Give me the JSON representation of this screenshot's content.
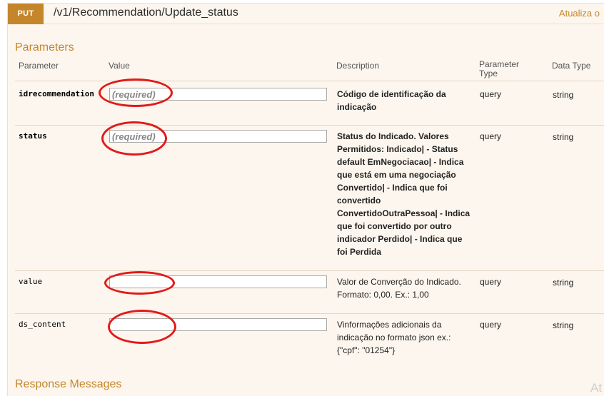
{
  "operation": {
    "method": "PUT",
    "path": "/v1/Recommendation/Update_status",
    "summary": "Atualiza o"
  },
  "sections": {
    "parameters_title": "Parameters",
    "response_title": "Response Messages"
  },
  "columns": {
    "parameter": "Parameter",
    "value": "Value",
    "description": "Description",
    "parameter_type": "Parameter Type",
    "data_type": "Data Type"
  },
  "params": [
    {
      "name": "idrecommendation",
      "placeholder": "(required)",
      "description": "Código de identificação da indicação",
      "param_type": "query",
      "data_type": "string"
    },
    {
      "name": "status",
      "placeholder": "(required)",
      "description": "Status do Indicado. Valores Permitidos: Indicado| - Status default EmNegociacao| - Indica que está em uma negociação Convertido| - Indica que foi convertido ConvertidoOutraPessoa| - Indica que foi convertido por outro indicador Perdido| - Indica que foi Perdida",
      "param_type": "query",
      "data_type": "string"
    },
    {
      "name": "value",
      "placeholder": "",
      "description": "Valor de Converção do Indicado. Formato: 0,00. Ex.: 1,00",
      "param_type": "query",
      "data_type": "string"
    },
    {
      "name": "ds_content",
      "placeholder": "",
      "description": "Vinformações adicionais da indicação no formato json ex.: {\"cpf\": \"01254\"}",
      "param_type": "query",
      "data_type": "string"
    }
  ],
  "watermark": "At",
  "annotation_color": "#e11a1a",
  "accent_color": "#c5862b"
}
